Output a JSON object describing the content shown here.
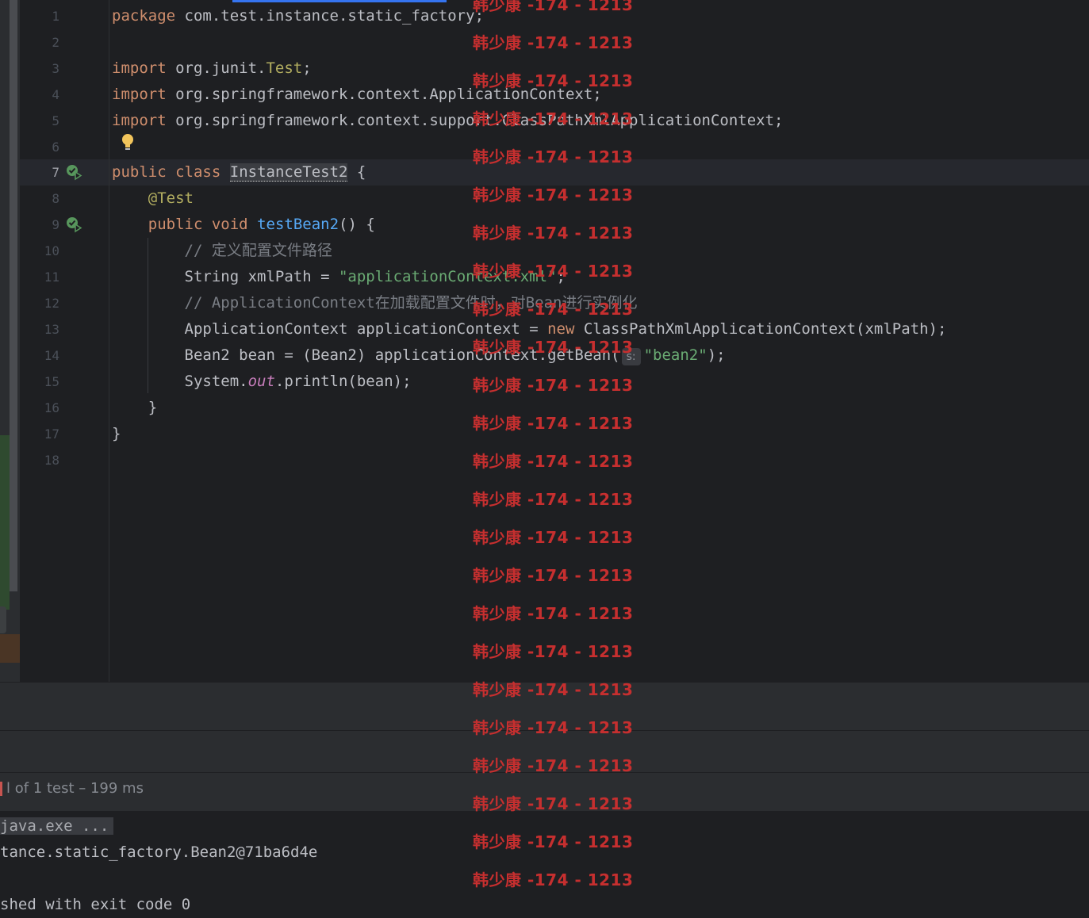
{
  "editor": {
    "line_numbers": [
      "1",
      "2",
      "3",
      "4",
      "5",
      "6",
      "7",
      "8",
      "9",
      "10",
      "11",
      "12",
      "13",
      "14",
      "15",
      "16",
      "17",
      "18"
    ],
    "lines": {
      "l1_kw": "package",
      "l1_rest": " com.test.instance.static_factory;",
      "l3_kw": "import",
      "l3_pkg": " org.junit.",
      "l3_cls": "Test",
      "l3_end": ";",
      "l4_kw": "import",
      "l4_rest": " org.springframework.context.ApplicationContext;",
      "l5_kw": "import",
      "l5_rest": " org.springframework.context.support.ClassPathXmlApplicationContext;",
      "l7_kw1": "public",
      "l7_kw2": "class",
      "l7_cls": "InstanceTest2",
      "l7_end": " {",
      "l8_ann": "@Test",
      "l9_kw1": "public",
      "l9_kw2": "void",
      "l9_fn": "testBean2",
      "l9_end": "() {",
      "l10_cmt": "// 定义配置文件路径",
      "l11_a": "String xmlPath = ",
      "l11_str": "\"applicationContext.xml\"",
      "l11_end": ";",
      "l12_cmt": "// ApplicationContext在加载配置文件时，对Bean进行实例化",
      "l13_a": "ApplicationContext applicationContext = ",
      "l13_kw": "new",
      "l13_b": " ClassPathXmlApplicationContext(xmlPath);",
      "l14_a": "Bean2 bean = (Bean2) applicationContext.getBean(",
      "l14_hint": "s:",
      "l14_str": "\"bean2\"",
      "l14_end": ");",
      "l15_a": "System.",
      "l15_field": "out",
      "l15_b": ".println(bean);",
      "l16": "}",
      "l17": "}"
    },
    "current_line": "7",
    "icons": {
      "run_icon": "run-test-gutter-icon",
      "bulb": "intention-bulb-icon"
    }
  },
  "run_panel": {
    "test_status": "l of 1 test – 199 ms",
    "command": "java.exe ...",
    "output_line": "tance.static_factory.Bean2@71ba6d4e",
    "exit_line": "shed with exit code 0"
  },
  "watermark": {
    "text": "韩少康 -174 - 1213"
  },
  "colors": {
    "background": "#1e1f22",
    "keyword": "#cf8e6d",
    "string": "#6aab73",
    "function": "#56a8f5",
    "watermark": "#c62f2f"
  }
}
